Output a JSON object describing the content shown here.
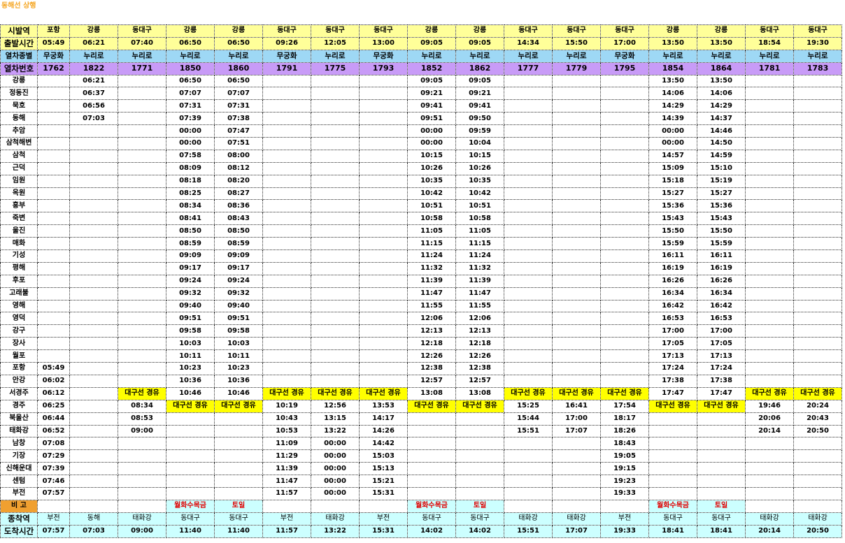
{
  "title": "동해선 상행",
  "labels": {
    "origin": "시발역",
    "departure": "출발시간",
    "train_type": "열차종별",
    "train_no": "열차번호",
    "remarks": "비 고",
    "terminal": "종착역",
    "arrival": "도착시간"
  },
  "trains": [
    {
      "origin": "포항",
      "dep": "05:49",
      "type": "무궁화",
      "no": "1762",
      "remark": "",
      "terminal": "부전",
      "arr": "07:57"
    },
    {
      "origin": "강릉",
      "dep": "06:21",
      "type": "누리로",
      "no": "1822",
      "remark": "",
      "terminal": "동해",
      "arr": "07:03"
    },
    {
      "origin": "동대구",
      "dep": "07:40",
      "type": "누리로",
      "no": "1771",
      "remark": "",
      "terminal": "태화강",
      "arr": "09:00"
    },
    {
      "origin": "강릉",
      "dep": "06:50",
      "type": "누리로",
      "no": "1850",
      "remark": "월화수목금",
      "terminal": "동대구",
      "arr": "11:40"
    },
    {
      "origin": "강릉",
      "dep": "06:50",
      "type": "누리로",
      "no": "1860",
      "remark": "토일",
      "terminal": "동대구",
      "arr": "11:40"
    },
    {
      "origin": "동대구",
      "dep": "09:26",
      "type": "무궁화",
      "no": "1791",
      "remark": "",
      "terminal": "부전",
      "arr": "11:57"
    },
    {
      "origin": "동대구",
      "dep": "12:05",
      "type": "누리로",
      "no": "1775",
      "remark": "",
      "terminal": "태화강",
      "arr": "13:22"
    },
    {
      "origin": "동대구",
      "dep": "13:00",
      "type": "무궁화",
      "no": "1793",
      "remark": "",
      "terminal": "부전",
      "arr": "15:31"
    },
    {
      "origin": "강릉",
      "dep": "09:05",
      "type": "누리로",
      "no": "1852",
      "remark": "월화수목금",
      "terminal": "동대구",
      "arr": "14:02"
    },
    {
      "origin": "강릉",
      "dep": "09:05",
      "type": "누리로",
      "no": "1862",
      "remark": "토일",
      "terminal": "동대구",
      "arr": "14:02"
    },
    {
      "origin": "동대구",
      "dep": "14:34",
      "type": "누리로",
      "no": "1777",
      "remark": "",
      "terminal": "태화강",
      "arr": "15:51"
    },
    {
      "origin": "동대구",
      "dep": "15:50",
      "type": "누리로",
      "no": "1779",
      "remark": "",
      "terminal": "태화강",
      "arr": "17:07"
    },
    {
      "origin": "동대구",
      "dep": "17:00",
      "type": "무궁화",
      "no": "1795",
      "remark": "",
      "terminal": "부전",
      "arr": "19:33"
    },
    {
      "origin": "강릉",
      "dep": "13:50",
      "type": "누리로",
      "no": "1854",
      "remark": "월화수목금",
      "terminal": "동대구",
      "arr": "18:41"
    },
    {
      "origin": "강릉",
      "dep": "13:50",
      "type": "누리로",
      "no": "1864",
      "remark": "토일",
      "terminal": "동대구",
      "arr": "18:41"
    },
    {
      "origin": "동대구",
      "dep": "18:54",
      "type": "누리로",
      "no": "1781",
      "remark": "",
      "terminal": "태화강",
      "arr": "20:14"
    },
    {
      "origin": "동대구",
      "dep": "19:30",
      "type": "누리로",
      "no": "1783",
      "remark": "",
      "terminal": "태화강",
      "arr": "20:50"
    }
  ],
  "stations": [
    {
      "name": "강릉",
      "times": [
        "",
        "06:21",
        "",
        "06:50",
        "06:50",
        "",
        "",
        "",
        "09:05",
        "09:05",
        "",
        "",
        "",
        "13:50",
        "13:50",
        "",
        ""
      ]
    },
    {
      "name": "정동진",
      "times": [
        "",
        "06:37",
        "",
        "07:07",
        "07:07",
        "",
        "",
        "",
        "09:21",
        "09:21",
        "",
        "",
        "",
        "14:06",
        "14:06",
        "",
        ""
      ]
    },
    {
      "name": "묵호",
      "times": [
        "",
        "06:56",
        "",
        "07:31",
        "07:31",
        "",
        "",
        "",
        "09:41",
        "09:41",
        "",
        "",
        "",
        "14:29",
        "14:29",
        "",
        ""
      ]
    },
    {
      "name": "동해",
      "times": [
        "",
        "07:03",
        "",
        "07:39",
        "07:38",
        "",
        "",
        "",
        "09:51",
        "09:50",
        "",
        "",
        "",
        "14:39",
        "14:37",
        "",
        ""
      ]
    },
    {
      "name": "추암",
      "times": [
        "",
        "",
        "",
        "00:00",
        "07:47",
        "",
        "",
        "",
        "00:00",
        "09:59",
        "",
        "",
        "",
        "00:00",
        "14:46",
        "",
        ""
      ]
    },
    {
      "name": "삼척해변",
      "times": [
        "",
        "",
        "",
        "00:00",
        "07:51",
        "",
        "",
        "",
        "00:00",
        "10:04",
        "",
        "",
        "",
        "00:00",
        "14:50",
        "",
        ""
      ]
    },
    {
      "name": "삼척",
      "times": [
        "",
        "",
        "",
        "07:58",
        "08:00",
        "",
        "",
        "",
        "10:15",
        "10:15",
        "",
        "",
        "",
        "14:57",
        "14:59",
        "",
        ""
      ]
    },
    {
      "name": "근덕",
      "times": [
        "",
        "",
        "",
        "08:09",
        "08:12",
        "",
        "",
        "",
        "10:26",
        "10:26",
        "",
        "",
        "",
        "15:09",
        "15:10",
        "",
        ""
      ]
    },
    {
      "name": "임원",
      "times": [
        "",
        "",
        "",
        "08:18",
        "08:20",
        "",
        "",
        "",
        "10:35",
        "10:35",
        "",
        "",
        "",
        "15:18",
        "15:19",
        "",
        ""
      ]
    },
    {
      "name": "옥원",
      "times": [
        "",
        "",
        "",
        "08:25",
        "08:27",
        "",
        "",
        "",
        "10:42",
        "10:42",
        "",
        "",
        "",
        "15:27",
        "15:27",
        "",
        ""
      ]
    },
    {
      "name": "흥부",
      "times": [
        "",
        "",
        "",
        "08:34",
        "08:36",
        "",
        "",
        "",
        "10:51",
        "10:51",
        "",
        "",
        "",
        "15:36",
        "15:36",
        "",
        ""
      ]
    },
    {
      "name": "죽변",
      "times": [
        "",
        "",
        "",
        "08:41",
        "08:43",
        "",
        "",
        "",
        "10:58",
        "10:58",
        "",
        "",
        "",
        "15:43",
        "15:43",
        "",
        ""
      ]
    },
    {
      "name": "울진",
      "times": [
        "",
        "",
        "",
        "08:50",
        "08:50",
        "",
        "",
        "",
        "11:05",
        "11:05",
        "",
        "",
        "",
        "15:50",
        "15:50",
        "",
        ""
      ]
    },
    {
      "name": "매화",
      "times": [
        "",
        "",
        "",
        "08:59",
        "08:59",
        "",
        "",
        "",
        "11:15",
        "11:15",
        "",
        "",
        "",
        "15:59",
        "15:59",
        "",
        ""
      ]
    },
    {
      "name": "기성",
      "times": [
        "",
        "",
        "",
        "09:09",
        "09:09",
        "",
        "",
        "",
        "11:24",
        "11:24",
        "",
        "",
        "",
        "16:11",
        "16:11",
        "",
        ""
      ]
    },
    {
      "name": "평해",
      "times": [
        "",
        "",
        "",
        "09:17",
        "09:17",
        "",
        "",
        "",
        "11:32",
        "11:32",
        "",
        "",
        "",
        "16:19",
        "16:19",
        "",
        ""
      ]
    },
    {
      "name": "후포",
      "times": [
        "",
        "",
        "",
        "09:24",
        "09:24",
        "",
        "",
        "",
        "11:39",
        "11:39",
        "",
        "",
        "",
        "16:26",
        "16:26",
        "",
        ""
      ]
    },
    {
      "name": "고래불",
      "times": [
        "",
        "",
        "",
        "09:32",
        "09:32",
        "",
        "",
        "",
        "11:47",
        "11:47",
        "",
        "",
        "",
        "16:34",
        "16:34",
        "",
        ""
      ]
    },
    {
      "name": "영해",
      "times": [
        "",
        "",
        "",
        "09:40",
        "09:40",
        "",
        "",
        "",
        "11:55",
        "11:55",
        "",
        "",
        "",
        "16:42",
        "16:42",
        "",
        ""
      ]
    },
    {
      "name": "영덕",
      "times": [
        "",
        "",
        "",
        "09:51",
        "09:51",
        "",
        "",
        "",
        "12:06",
        "12:06",
        "",
        "",
        "",
        "16:53",
        "16:53",
        "",
        ""
      ]
    },
    {
      "name": "강구",
      "times": [
        "",
        "",
        "",
        "09:58",
        "09:58",
        "",
        "",
        "",
        "12:13",
        "12:13",
        "",
        "",
        "",
        "17:00",
        "17:00",
        "",
        ""
      ]
    },
    {
      "name": "장사",
      "times": [
        "",
        "",
        "",
        "10:03",
        "10:03",
        "",
        "",
        "",
        "12:18",
        "12:18",
        "",
        "",
        "",
        "17:05",
        "17:05",
        "",
        ""
      ]
    },
    {
      "name": "월포",
      "times": [
        "",
        "",
        "",
        "10:11",
        "10:11",
        "",
        "",
        "",
        "12:26",
        "12:26",
        "",
        "",
        "",
        "17:13",
        "17:13",
        "",
        ""
      ]
    },
    {
      "name": "포항",
      "times": [
        "05:49",
        "",
        "",
        "10:23",
        "10:23",
        "",
        "",
        "",
        "12:38",
        "12:38",
        "",
        "",
        "",
        "17:24",
        "17:24",
        "",
        ""
      ]
    },
    {
      "name": "안강",
      "times": [
        "06:02",
        "",
        "",
        "10:36",
        "10:36",
        "",
        "",
        "",
        "12:57",
        "12:57",
        "",
        "",
        "",
        "17:38",
        "17:38",
        "",
        ""
      ]
    },
    {
      "name": "서경주",
      "times": [
        "06:12",
        "",
        "대구선 경유",
        "10:46",
        "10:46",
        "대구선 경유",
        "대구선 경유",
        "대구선 경유",
        "13:08",
        "13:08",
        "대구선 경유",
        "대구선 경유",
        "대구선 경유",
        "17:47",
        "17:47",
        "대구선 경유",
        "대구선 경유"
      ]
    },
    {
      "name": "경주",
      "times": [
        "06:25",
        "",
        "08:34",
        "대구선 경유",
        "대구선 경유",
        "10:19",
        "12:56",
        "13:53",
        "대구선 경유",
        "대구선 경유",
        "15:25",
        "16:41",
        "17:54",
        "대구선 경유",
        "대구선 경유",
        "19:46",
        "20:24"
      ]
    },
    {
      "name": "북울산",
      "times": [
        "06:44",
        "",
        "08:53",
        "",
        "",
        "10:43",
        "13:15",
        "14:17",
        "",
        "",
        "15:44",
        "17:00",
        "18:17",
        "",
        "",
        "20:06",
        "20:43"
      ]
    },
    {
      "name": "태화강",
      "times": [
        "06:52",
        "",
        "09:00",
        "",
        "",
        "10:53",
        "13:22",
        "14:26",
        "",
        "",
        "15:51",
        "17:07",
        "18:26",
        "",
        "",
        "20:14",
        "20:50"
      ]
    },
    {
      "name": "남창",
      "times": [
        "07:08",
        "",
        "",
        "",
        "",
        "11:09",
        "00:00",
        "14:42",
        "",
        "",
        "",
        "",
        "18:43",
        "",
        "",
        "",
        ""
      ]
    },
    {
      "name": "기장",
      "times": [
        "07:29",
        "",
        "",
        "",
        "",
        "11:29",
        "00:00",
        "15:03",
        "",
        "",
        "",
        "",
        "19:05",
        "",
        "",
        "",
        ""
      ]
    },
    {
      "name": "신해운대",
      "times": [
        "07:39",
        "",
        "",
        "",
        "",
        "11:39",
        "00:00",
        "15:13",
        "",
        "",
        "",
        "",
        "19:15",
        "",
        "",
        "",
        ""
      ]
    },
    {
      "name": "센텀",
      "times": [
        "07:46",
        "",
        "",
        "",
        "",
        "11:47",
        "00:00",
        "15:21",
        "",
        "",
        "",
        "",
        "19:23",
        "",
        "",
        "",
        ""
      ]
    },
    {
      "name": "부전",
      "times": [
        "07:57",
        "",
        "",
        "",
        "",
        "11:57",
        "00:00",
        "15:31",
        "",
        "",
        "",
        "",
        "19:33",
        "",
        "",
        "",
        ""
      ]
    }
  ],
  "colors": {
    "title": "#f5a623",
    "header_yellow": "#ffff99",
    "train_type_blue": "#9ed8f5",
    "train_no_purple": "#c89bf7",
    "note_yellow": "#ffff00",
    "remarks_orange": "#f0a030",
    "terminal_cyan": "#ccffff",
    "remark_red": "#e00000"
  }
}
